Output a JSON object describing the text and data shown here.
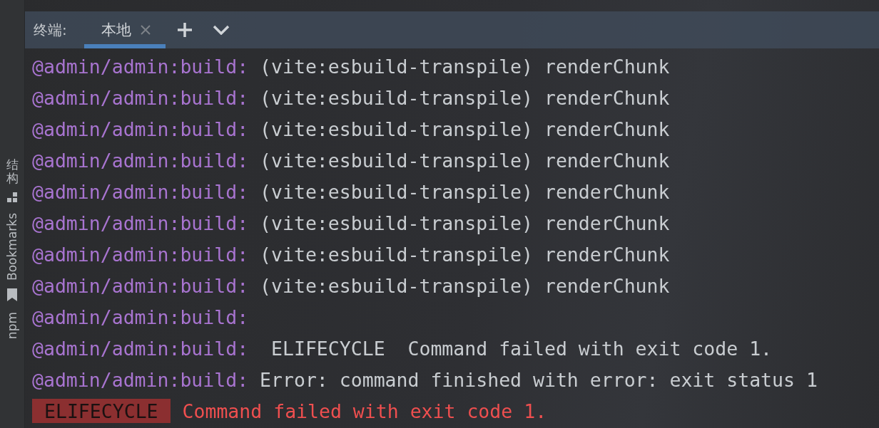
{
  "side_panel": {
    "items": [
      {
        "label": "结构",
        "kind": "stacked"
      },
      {
        "label": "Bookmarks",
        "kind": "rotated"
      },
      {
        "label": "npm",
        "kind": "rotated"
      }
    ]
  },
  "terminal": {
    "title": "终端:",
    "tabs": [
      {
        "label": "本地",
        "selected": true
      }
    ],
    "lines": [
      {
        "kind": "log",
        "prefix": "@admin/admin:build:",
        "text": " (vite:esbuild-transpile) renderChunk"
      },
      {
        "kind": "log",
        "prefix": "@admin/admin:build:",
        "text": " (vite:esbuild-transpile) renderChunk"
      },
      {
        "kind": "log",
        "prefix": "@admin/admin:build:",
        "text": " (vite:esbuild-transpile) renderChunk"
      },
      {
        "kind": "log",
        "prefix": "@admin/admin:build:",
        "text": " (vite:esbuild-transpile) renderChunk"
      },
      {
        "kind": "log",
        "prefix": "@admin/admin:build:",
        "text": " (vite:esbuild-transpile) renderChunk"
      },
      {
        "kind": "log",
        "prefix": "@admin/admin:build:",
        "text": " (vite:esbuild-transpile) renderChunk"
      },
      {
        "kind": "log",
        "prefix": "@admin/admin:build:",
        "text": " (vite:esbuild-transpile) renderChunk"
      },
      {
        "kind": "log",
        "prefix": "@admin/admin:build:",
        "text": " (vite:esbuild-transpile) renderChunk"
      },
      {
        "kind": "log",
        "prefix": "@admin/admin:build:"
      },
      {
        "kind": "log",
        "prefix": "@admin/admin:build:",
        "text": "  ELIFECYCLE  Command failed with exit code 1."
      },
      {
        "kind": "log",
        "prefix": "@admin/admin:build:",
        "text": " Error: command finished with error: exit status 1"
      },
      {
        "kind": "error",
        "badge": "ELIFECYCLE",
        "text": "Command failed with exit code 1."
      }
    ]
  }
}
